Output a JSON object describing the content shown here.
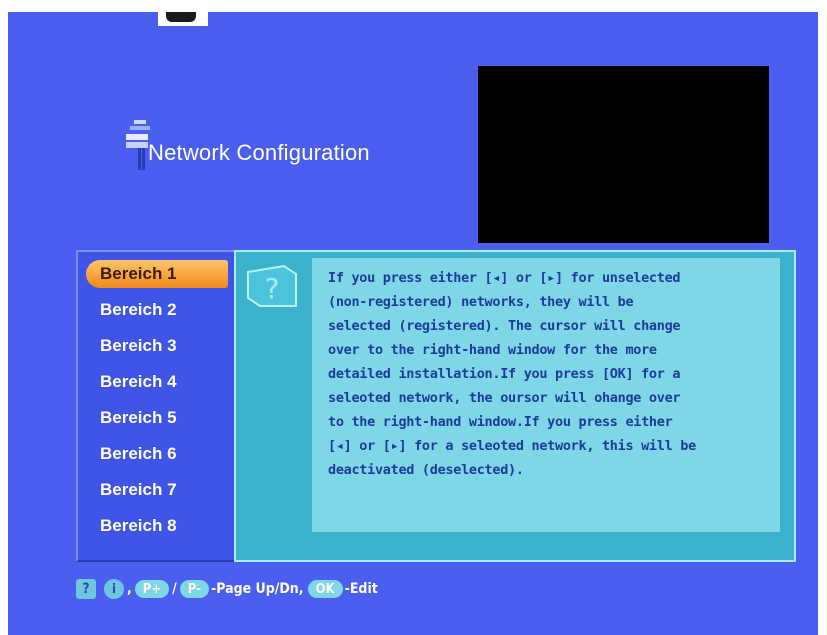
{
  "screen": {
    "title": "Network Configuration",
    "title_icon": "satellite-dish-icon"
  },
  "list": {
    "items": [
      {
        "label": "Bereich 1",
        "selected": true
      },
      {
        "label": "Bereich 2",
        "selected": false
      },
      {
        "label": "Bereich 3",
        "selected": false
      },
      {
        "label": "Bereich 4",
        "selected": false
      },
      {
        "label": "Bereich 5",
        "selected": false
      },
      {
        "label": "Bereich 6",
        "selected": false
      },
      {
        "label": "Bereich 7",
        "selected": false
      },
      {
        "label": "Bereich 8",
        "selected": false
      }
    ]
  },
  "help": {
    "icon": "help-question-icon",
    "text": "If you press either [◂] or [▸] for unselected\n(non-registered) networks, they will be\nselected (registered). The cursor will change\nover to the right-hand window for the more\ndetailed installation.If you press [OK] for a\nseleoted network, the oursor will ohange over\nto the right-hand window.If you press either\n[◂] or [▸] for a seleoted network, this will be\ndeactivated (deselected)."
  },
  "footer": {
    "help_key": "?",
    "info_key": "i",
    "comma1": ",",
    "pplus": "P+",
    "slash": "/",
    "pminus": "P-",
    "page_text": "-Page Up/Dn,",
    "ok": "OK",
    "edit_text": "-Edit"
  },
  "colors": {
    "background": "#4a5ff0",
    "selected_item": "#f08a1a",
    "help_panel": "#7fd6e6",
    "help_text": "#1c3b9a"
  }
}
